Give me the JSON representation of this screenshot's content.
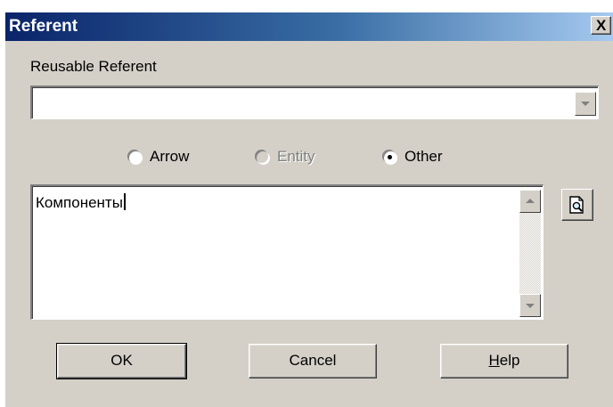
{
  "dialog": {
    "title": "Referent",
    "close_glyph": "X"
  },
  "reusable": {
    "label": "Reusable Referent",
    "value": ""
  },
  "radios": {
    "arrow": {
      "label": "Arrow",
      "checked": false,
      "enabled": true
    },
    "entity": {
      "label": "Entity",
      "checked": false,
      "enabled": false
    },
    "other": {
      "label": "Other",
      "checked": true,
      "enabled": true
    }
  },
  "text_box": {
    "value": "Компоненты"
  },
  "buttons": {
    "ok": "OK",
    "cancel": "Cancel",
    "help_mnemonic": "H",
    "help_rest": "elp"
  },
  "icons": {
    "close": "close-icon",
    "combo_arrow": "chevron-down-icon",
    "browse": "document-search-icon"
  },
  "colors": {
    "titlebar_start": "#0a246a",
    "titlebar_end": "#a6caf0",
    "face": "#d4d0c8"
  }
}
